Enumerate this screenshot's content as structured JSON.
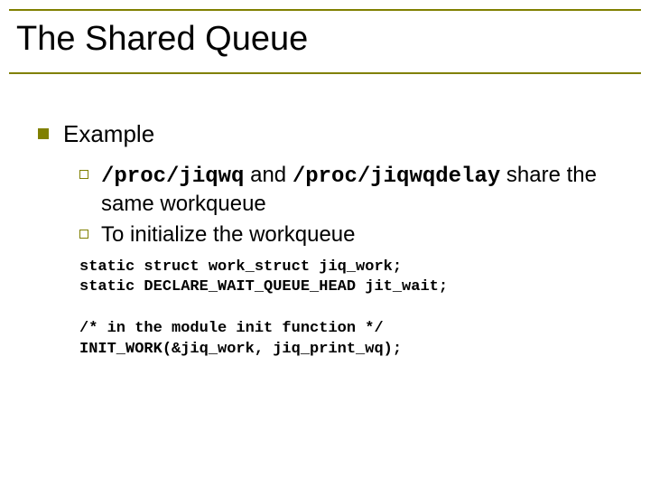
{
  "title": "The Shared Queue",
  "bullet1": "Example",
  "sub1": {
    "code1": "/proc/jiqwq",
    "mid": " and ",
    "code2": "/proc/jiqwqdelay",
    "tail": " share the same workqueue"
  },
  "sub2": "To initialize the workqueue",
  "code": {
    "l1": "static struct work_struct jiq_work;",
    "l2": "static DECLARE_WAIT_QUEUE_HEAD jit_wait;",
    "l3": "",
    "l4": "/* in the module init function */",
    "l5": "INIT_WORK(&jiq_work, jiq_print_wq);"
  }
}
